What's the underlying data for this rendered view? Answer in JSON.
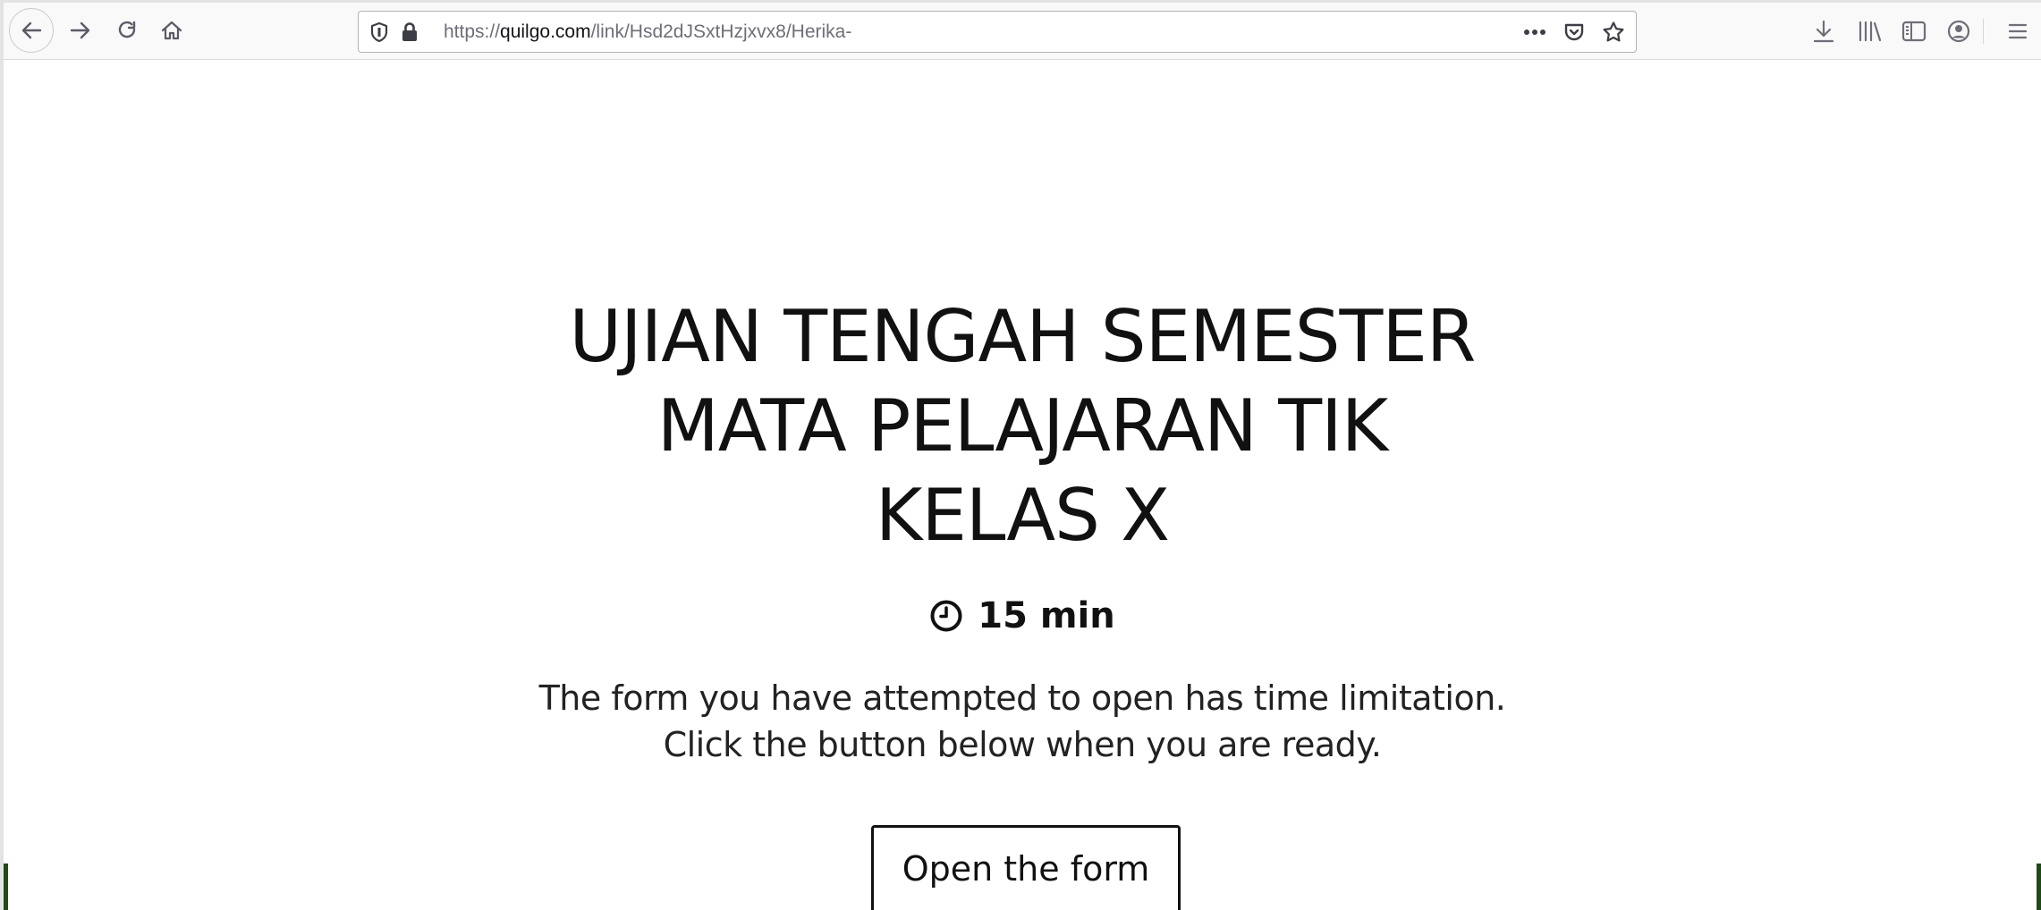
{
  "browser": {
    "url_prefix": "https://",
    "url_host": "quilgo.com",
    "url_path": "/link/Hsd2dJSxtHzjxvx8/Herika-",
    "icons": {
      "back": "back-arrow-icon",
      "forward": "forward-arrow-icon",
      "reload": "reload-icon",
      "home": "home-icon",
      "tracking": "shield-icon",
      "secure": "lock-icon",
      "page_actions": "more-dots-icon",
      "pocket": "pocket-icon",
      "bookmark": "star-icon",
      "downloads": "download-icon",
      "library": "library-icon",
      "sidebar": "sidebar-icon",
      "account": "account-icon",
      "menu": "hamburger-menu-icon"
    }
  },
  "page": {
    "title_lines": [
      "UJIAN TENGAH SEMESTER",
      "MATA PELAJARAN TIK",
      "KELAS X"
    ],
    "duration": "15 min",
    "notice_lines": [
      "The form you have attempted to open has time limitation.",
      "Click the button below when you are ready."
    ],
    "open_button_label": "Open the form"
  },
  "colors": {
    "text": "#111111",
    "toolbar_bg": "#f9f9fa",
    "edge_accent": "#1e4b14"
  }
}
